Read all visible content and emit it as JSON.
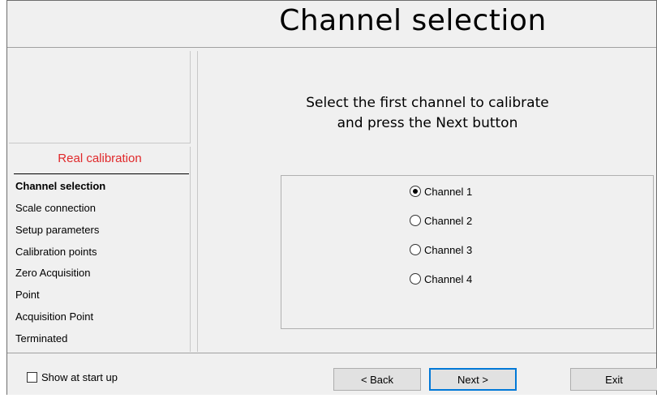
{
  "title": "Channel selection",
  "steps": {
    "header": "Real calibration",
    "items": [
      {
        "label": "Channel selection",
        "active": true
      },
      {
        "label": "Scale connection"
      },
      {
        "label": "Setup parameters"
      },
      {
        "label": "Calibration points"
      },
      {
        "label": "Zero Acquisition"
      },
      {
        "label": "Point"
      },
      {
        "label": "Acquisition Point"
      },
      {
        "label": "Terminated"
      }
    ]
  },
  "instruction": {
    "line1": "Select the first channel to calibrate",
    "line2": "and press the Next button"
  },
  "channels": [
    {
      "label": "Channel 1",
      "selected": true
    },
    {
      "label": "Channel 2",
      "selected": false
    },
    {
      "label": "Channel 3",
      "selected": false
    },
    {
      "label": "Channel 4",
      "selected": false
    }
  ],
  "footer": {
    "show_at_startup_label": "Show at start up",
    "show_at_startup_checked": false,
    "back_label": "< Back",
    "next_label": "Next >",
    "exit_label": "Exit"
  },
  "colors": {
    "steps_header": "#e0282a",
    "default_button_border": "#0078d7"
  }
}
